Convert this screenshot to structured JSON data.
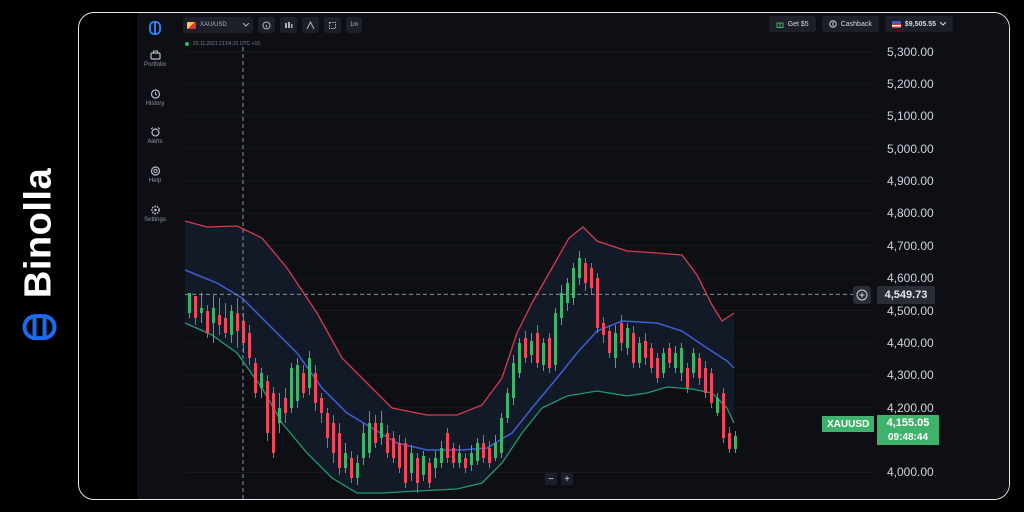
{
  "brand": {
    "name": "Binolla",
    "color": "#1a6cf5"
  },
  "sidebar": {
    "items": [
      {
        "label": "Portfolio",
        "icon": "briefcase-icon"
      },
      {
        "label": "History",
        "icon": "history-icon"
      },
      {
        "label": "Alerts",
        "icon": "alarm-icon"
      },
      {
        "label": "Help",
        "icon": "help-icon"
      },
      {
        "label": "Settings",
        "icon": "gear-icon"
      }
    ]
  },
  "toolbar": {
    "asset": "XAU/USD",
    "timeframe": "1m",
    "icons": [
      "info-icon",
      "candles-icon",
      "indicator-icon",
      "drawing-icon"
    ]
  },
  "account": {
    "bonus_label": "Get $5",
    "cashback_label": "Cashback",
    "balance": "$9,505.55"
  },
  "chart": {
    "info_text": "23.11.2021  21:04:31  UTC +10",
    "symbol": "XAUUSD",
    "crosshair_price": "4,549.73",
    "current_price": "4,155.05",
    "countdown": "09:48:44",
    "price_ticks": [
      "5,300.00",
      "5,200.00",
      "5,100.00",
      "5,000.00",
      "4,900.00",
      "4,800.00",
      "4,700.00",
      "4,600.00",
      "4,500.00",
      "4,400.00",
      "4,300.00",
      "4,200.00",
      "4,000.00"
    ],
    "zoom_out": "−",
    "zoom_in": "+",
    "colors": {
      "up": "#3fb26b",
      "down": "#f0485a",
      "mid_band": "#3b5fd6",
      "upper_band": "#d83a50",
      "lower_band": "#1f9a6e"
    }
  },
  "chart_data": {
    "type": "candlestick",
    "symbol": "XAUUSD",
    "ylim": [
      3960,
      5340
    ],
    "price_ticks": [
      5300,
      5200,
      5100,
      5000,
      4900,
      4800,
      4700,
      4600,
      4500,
      4400,
      4300,
      4200,
      4000
    ],
    "current_price": 4155.05,
    "crosshair_price": 4549.73
  }
}
